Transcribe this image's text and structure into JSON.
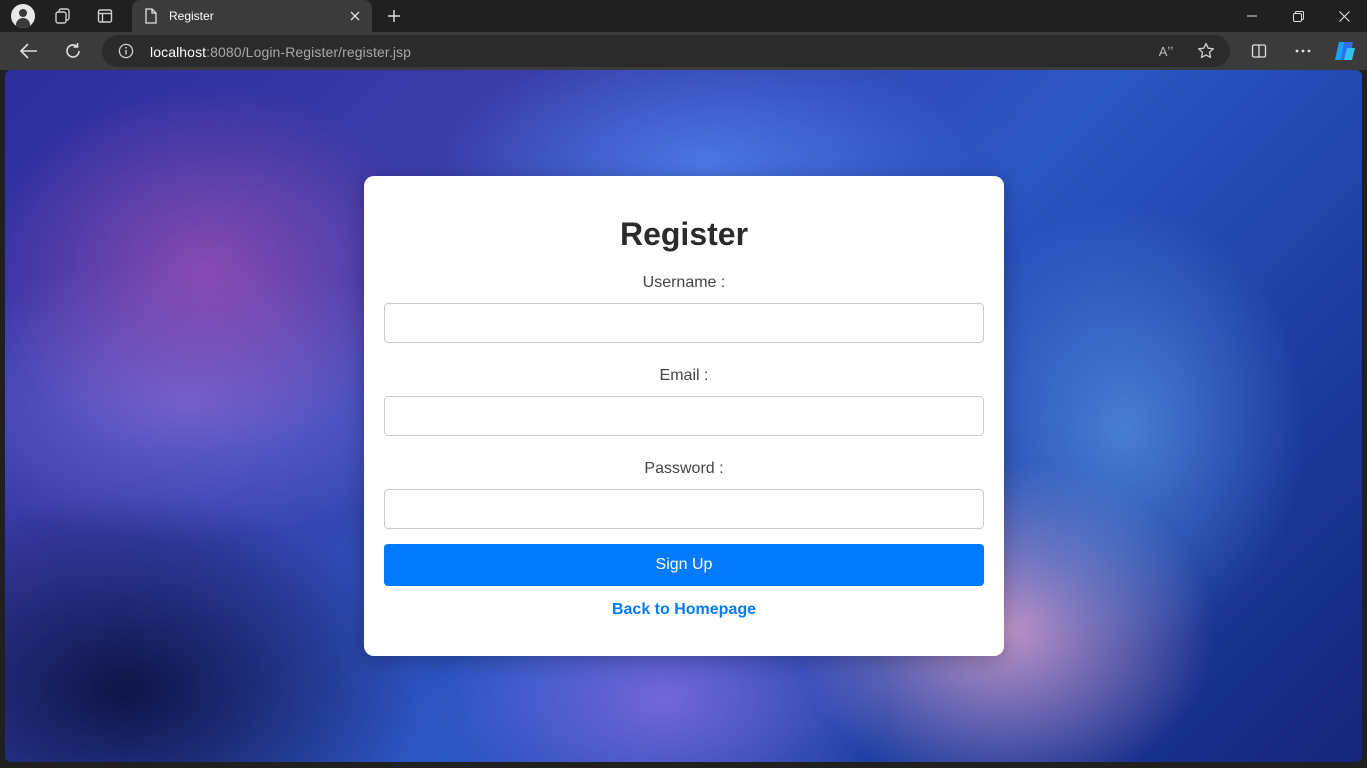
{
  "browser": {
    "tab": {
      "title": "Register"
    },
    "address": {
      "host": "localhost",
      "rest": ":8080/Login-Register/register.jsp"
    },
    "read_aloud_glyph": "Aʼʼ"
  },
  "page": {
    "heading": "Register",
    "fields": {
      "username_label": "Username :",
      "email_label": "Email :",
      "password_label": "Password :"
    },
    "signup_label": "Sign Up",
    "home_link": "Back to Homepage"
  },
  "colors": {
    "accent": "#007bff",
    "chrome_bg": "#202020",
    "toolbar_bg": "#3b3b3b"
  }
}
